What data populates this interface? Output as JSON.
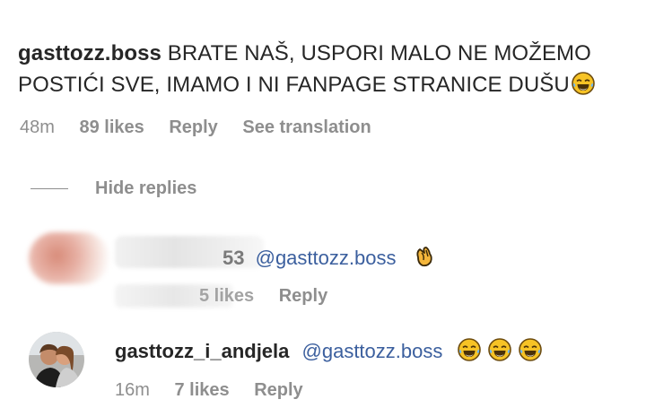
{
  "comment": {
    "username": "gasttozz.boss",
    "text_line1": "BRATE NAŠ, USPORI MALO NE MOŽEMO",
    "text_line2": "POSTIĆI SVE, IMAMO I NI FANPAGE STRANICE DUŠU",
    "emoji": "laughing-tears-icon",
    "time": "48m",
    "likes": "89 likes",
    "reply_label": "Reply",
    "translate_label": "See translation"
  },
  "hide_replies_label": "Hide replies",
  "replies": [
    {
      "username_suffix": "53",
      "mention": "@gasttozz.boss",
      "emoji": "clapping-hands-icon",
      "likes": "5 likes",
      "reply_label": "Reply"
    },
    {
      "username": "gasttozz_i_andjela",
      "mention": "@gasttozz.boss",
      "emoji": "laughing-tears-icon",
      "time": "16m",
      "likes": "7 likes",
      "reply_label": "Reply"
    }
  ]
}
